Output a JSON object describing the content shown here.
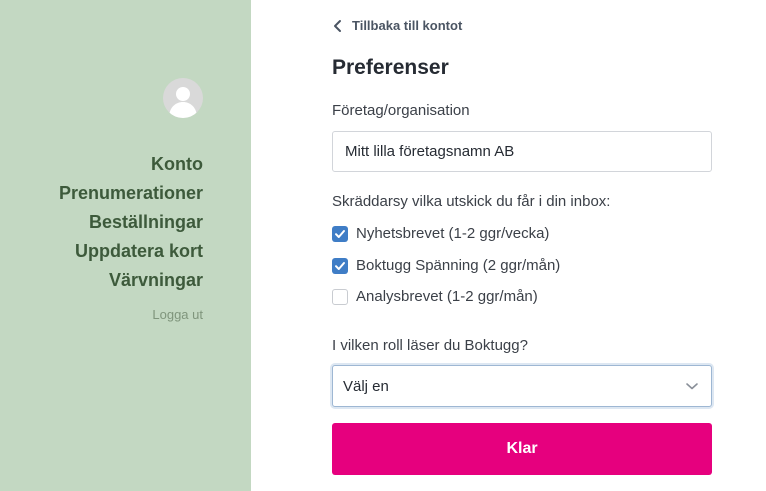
{
  "sidebar": {
    "avatar_icon": "user-silhouette-icon",
    "nav": [
      {
        "label": "Konto"
      },
      {
        "label": "Prenumerationer"
      },
      {
        "label": "Beställningar"
      },
      {
        "label": "Uppdatera kort"
      },
      {
        "label": "Värvningar"
      }
    ],
    "logout_label": "Logga ut"
  },
  "main": {
    "back_label": "Tillbaka till kontot",
    "title": "Preferenser",
    "company_label": "Företag/organisation",
    "company_value": "Mitt lilla företagsnamn AB",
    "newsletter_prompt": "Skräddarsy vilka utskick du får i din inbox:",
    "newsletters": [
      {
        "label": "Nyhetsbrevet (1-2 ggr/vecka)",
        "checked": true
      },
      {
        "label": "Boktugg Spänning (2 ggr/mån)",
        "checked": true
      },
      {
        "label": "Analysbrevet (1-2 ggr/mån)",
        "checked": false
      }
    ],
    "role_label": "I vilken roll läser du Boktugg?",
    "role_select_value": "Välj en",
    "submit_label": "Klar"
  },
  "colors": {
    "sidebar_bg": "#c3d8c2",
    "nav_text": "#3d5a3b",
    "checkbox_checked": "#3f7dc6",
    "submit_bg": "#e6007e"
  }
}
